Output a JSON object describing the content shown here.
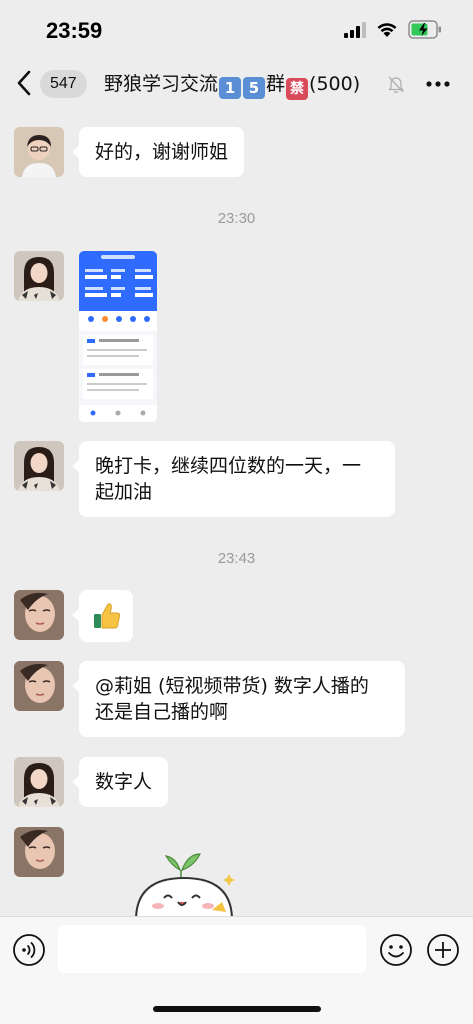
{
  "status_bar": {
    "time": "23:59"
  },
  "header": {
    "unread_count": "547",
    "title_prefix": "野狼学习交流",
    "title_emoji_1": "1",
    "title_emoji_2": "5",
    "title_middle": "群",
    "title_emoji_3": "禁",
    "title_suffix": "(500)"
  },
  "messages": [
    {
      "type": "text",
      "text": "好的，谢谢师姐"
    },
    {
      "type": "timestamp",
      "text": "23:30"
    },
    {
      "type": "image",
      "description_icon": "app-screenshot-image"
    },
    {
      "type": "text",
      "line1": "晚打卡，继续四位数的一天，一",
      "line2": "起加油"
    },
    {
      "type": "timestamp",
      "text": "23:43"
    },
    {
      "type": "emoji",
      "icon": "thumbs-up-icon"
    },
    {
      "type": "text",
      "line1": "@莉姐 (短视频带货) 数字人播的",
      "line2": "还是自己播的啊"
    },
    {
      "type": "text",
      "text": "数字人"
    },
    {
      "type": "sticker",
      "icon": "sprout-bun-sticker"
    }
  ],
  "colors": {
    "background": "#ededed",
    "bubble": "#ffffff",
    "battery_green": "#34c759",
    "thumb_blue": "#2f6bff"
  }
}
